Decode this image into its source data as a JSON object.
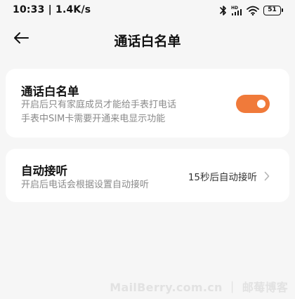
{
  "status_bar": {
    "time_speed": "10:33 | 1.4K/s",
    "battery_level": "51",
    "icons": [
      "bluetooth-icon",
      "hd-signal-icon",
      "wifi-icon",
      "battery-icon"
    ]
  },
  "header": {
    "title": "通话白名单",
    "back_icon": "arrow-left-icon"
  },
  "whitelist_card": {
    "title": "通话白名单",
    "description_line1": "开启后只有家庭成员才能给手表打电话",
    "description_line2": "手表中SIM卡需要开通来电显示功能",
    "toggle_on": true,
    "toggle_color": "#f07a3a"
  },
  "auto_answer_card": {
    "title": "自动接听",
    "description": "开启后电话会根据设置自动接听",
    "value": "15秒后自动接听",
    "chevron_icon": "chevron-right-icon"
  },
  "watermark": {
    "text": "MailBerry.com.cn ｜ 邮莓博客"
  }
}
